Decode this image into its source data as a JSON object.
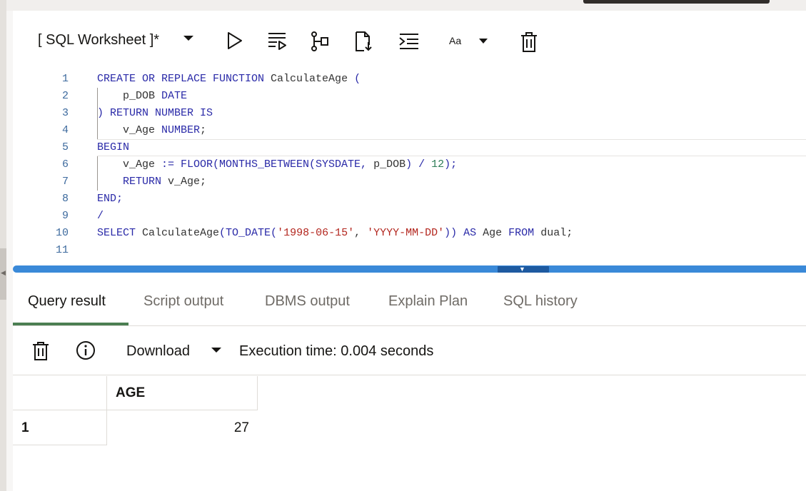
{
  "worksheet": {
    "title": "[ SQL Worksheet ]*"
  },
  "toolbar": {
    "icons": [
      "run-icon",
      "run-script-icon",
      "explain-plan-icon",
      "autotrace-icon",
      "format-icon",
      "font-size-icon",
      "clear-icon"
    ],
    "font_label": "Aa"
  },
  "editor": {
    "lines": [
      {
        "n": "1",
        "tokens": [
          {
            "t": "CREATE OR REPLACE FUNCTION ",
            "c": "kw"
          },
          {
            "t": "CalculateAge ",
            "c": ""
          },
          {
            "t": "(",
            "c": "op"
          }
        ]
      },
      {
        "n": "2",
        "tokens": [
          {
            "t": "    p_DOB ",
            "c": ""
          },
          {
            "t": "DATE",
            "c": "kw"
          }
        ]
      },
      {
        "n": "3",
        "tokens": [
          {
            "t": ") RETURN NUMBER IS",
            "c": "kw"
          }
        ]
      },
      {
        "n": "4",
        "tokens": [
          {
            "t": "    v_Age ",
            "c": ""
          },
          {
            "t": "NUMBER",
            "c": "kw"
          },
          {
            "t": ";",
            "c": ""
          }
        ]
      },
      {
        "n": "5",
        "tokens": [
          {
            "t": "BEGIN",
            "c": "kw"
          }
        ]
      },
      {
        "n": "6",
        "tokens": [
          {
            "t": "    v_Age ",
            "c": ""
          },
          {
            "t": ":= FLOOR(MONTHS_BETWEEN(SYSDATE, ",
            "c": "kw"
          },
          {
            "t": "p_DOB",
            "c": ""
          },
          {
            "t": ") / ",
            "c": "op"
          },
          {
            "t": "12",
            "c": "num"
          },
          {
            "t": ");",
            "c": "op"
          }
        ]
      },
      {
        "n": "7",
        "tokens": [
          {
            "t": "    RETURN ",
            "c": "kw"
          },
          {
            "t": "v_Age;",
            "c": ""
          }
        ]
      },
      {
        "n": "8",
        "tokens": [
          {
            "t": "END;",
            "c": "kw"
          }
        ]
      },
      {
        "n": "9",
        "tokens": [
          {
            "t": "/",
            "c": "op"
          }
        ]
      },
      {
        "n": "10",
        "tokens": [
          {
            "t": "SELECT ",
            "c": "kw"
          },
          {
            "t": "CalculateAge",
            "c": ""
          },
          {
            "t": "(TO_DATE(",
            "c": "kw"
          },
          {
            "t": "'1998-06-15'",
            "c": "str"
          },
          {
            "t": ", ",
            "c": ""
          },
          {
            "t": "'YYYY-MM-DD'",
            "c": "str"
          },
          {
            "t": ")) AS ",
            "c": "kw"
          },
          {
            "t": "Age ",
            "c": ""
          },
          {
            "t": "FROM ",
            "c": "kw"
          },
          {
            "t": "dual;",
            "c": ""
          }
        ]
      },
      {
        "n": "11",
        "tokens": []
      }
    ]
  },
  "tabs": [
    {
      "label": "Query result",
      "active": true
    },
    {
      "label": "Script output",
      "active": false
    },
    {
      "label": "DBMS output",
      "active": false
    },
    {
      "label": "Explain Plan",
      "active": false
    },
    {
      "label": "SQL history",
      "active": false
    }
  ],
  "result_toolbar": {
    "download_label": "Download",
    "execution_time": "Execution time: 0.004 seconds"
  },
  "result": {
    "columns": [
      "AGE"
    ],
    "rows": [
      {
        "row_num": "1",
        "values": [
          "27"
        ]
      }
    ]
  },
  "colors": {
    "accent": "#3a89d8",
    "tab_active": "#4b7f52",
    "keyword": "#2a2aa8",
    "string": "#b3261e",
    "number": "#2e7d57"
  }
}
